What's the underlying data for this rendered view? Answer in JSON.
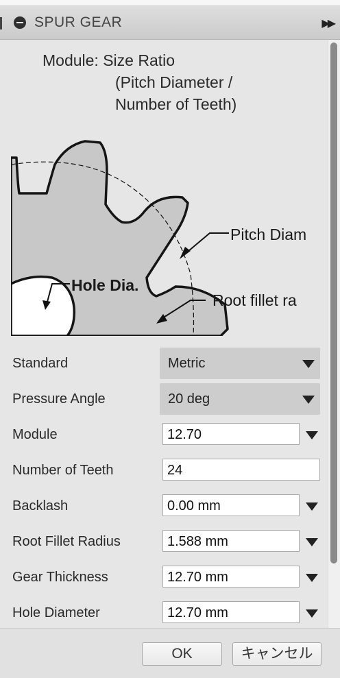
{
  "dialog": {
    "title": "SPUR GEAR"
  },
  "help": {
    "line1": "Module: Size Ratio",
    "line2": "(Pitch Diameter /",
    "line3": "Number of Teeth)",
    "labels": {
      "pitch": "Pitch Diam",
      "root": "Root fillet ra",
      "hole": "Hole Dia."
    }
  },
  "fields": {
    "standard": {
      "label": "Standard",
      "value": "Metric"
    },
    "pressure_angle": {
      "label": "Pressure Angle",
      "value": "20 deg"
    },
    "module": {
      "label": "Module",
      "value": "12.70"
    },
    "number_of_teeth": {
      "label": "Number of Teeth",
      "value": "24"
    },
    "backlash": {
      "label": "Backlash",
      "value": "0.00 mm"
    },
    "root_fillet_radius": {
      "label": "Root Fillet Radius",
      "value": "1.588 mm"
    },
    "gear_thickness": {
      "label": "Gear Thickness",
      "value": "12.70 mm"
    },
    "hole_diameter": {
      "label": "Hole Diameter",
      "value": "12.70 mm"
    }
  },
  "buttons": {
    "ok": "OK",
    "cancel": "キャンセル"
  },
  "icons": {
    "collapse": "minus-circle-icon",
    "expand": "fast-forward-icon",
    "dropdown": "triangle-down-icon"
  },
  "colors": {
    "panel_bg": "#e6e6e6",
    "select_bg": "#cdcdcd",
    "gear_fill": "#c8c8c8"
  }
}
